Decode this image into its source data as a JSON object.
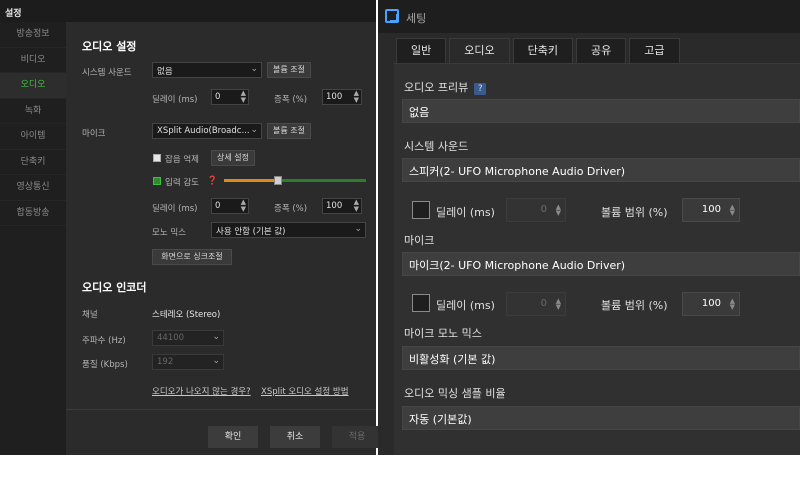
{
  "left": {
    "title": "설정",
    "sidebar": [
      "방송정보",
      "비디오",
      "오디오",
      "녹화",
      "아이템",
      "단축키",
      "영상통신",
      "합동방송"
    ],
    "active_sidebar_index": 2,
    "audio_settings": {
      "title": "오디오 설정",
      "system_sound_label": "시스템 사운드",
      "system_sound_value": "없음",
      "volume_adjust_btn": "볼륨 조절",
      "delay_label": "딜레이 (ms)",
      "delay_value": "0",
      "gain_label": "증폭 (%)",
      "gain_value": "100",
      "mic_label": "마이크",
      "mic_value": "XSplit Audio(Broadc...",
      "mic_volume_btn": "볼륨 조절",
      "noise_suppress_label": "잡음 억제",
      "noise_suppress_checked": false,
      "detail_settings_btn": "상세 설정",
      "input_sensitivity_label": "입력 감도",
      "input_sensitivity_checked": true,
      "input_sensitivity_level": 0.38,
      "mic_delay_label": "딜레이 (ms)",
      "mic_delay_value": "0",
      "mic_gain_label": "증폭 (%)",
      "mic_gain_value": "100",
      "mono_mix_label": "모노 믹스",
      "mono_mix_value": "사용 안함 (기본 값)",
      "screen_sync_btn": "화면으로 싱크조절"
    },
    "encoder": {
      "title": "오디오 인코더",
      "channel_label": "채널",
      "channel_value": "스테레오 (Stereo)",
      "freq_label": "주파수 (Hz)",
      "freq_value": "44100",
      "quality_label": "품질 (Kbps)",
      "quality_value": "192",
      "link_no_audio": "오디오가 나오지 않는 경우?",
      "link_xsplit": "XSplit 오디오 설정 방법"
    },
    "footer": {
      "ok": "확인",
      "cancel": "취소",
      "apply": "적용"
    }
  },
  "right": {
    "title": "세팅",
    "tabs": [
      "일반",
      "오디오",
      "단축키",
      "공유",
      "고급"
    ],
    "active_tab_index": 1,
    "audio_preview_label": "오디오 프리뷰",
    "help_icon_text": "?",
    "audio_preview_value": "없음",
    "system_sound_label": "시스템 사운드",
    "system_sound_value": "스피커(2- UFO Microphone Audio Driver)",
    "sys_delay_label": "딜레이 (ms)",
    "sys_delay_value": "0",
    "sys_volume_label": "볼륨 범위 (%)",
    "sys_volume_value": "100",
    "mic_label": "마이크",
    "mic_value": "마이크(2- UFO Microphone Audio Driver)",
    "mic_delay_label": "딜레이 (ms)",
    "mic_delay_value": "0",
    "mic_volume_label": "볼륨 범위 (%)",
    "mic_volume_value": "100",
    "mic_mono_label": "마이크 모노 믹스",
    "mic_mono_value": "비활성화 (기본 값)",
    "mix_rate_label": "오디오 믹싱 샘플 비율",
    "mix_rate_value": "자동 (기본값)"
  },
  "colors": {
    "accent_green": "#3fbf3f",
    "slider_orange": "#d98c1a",
    "brand_blue": "#4aa3ff"
  }
}
